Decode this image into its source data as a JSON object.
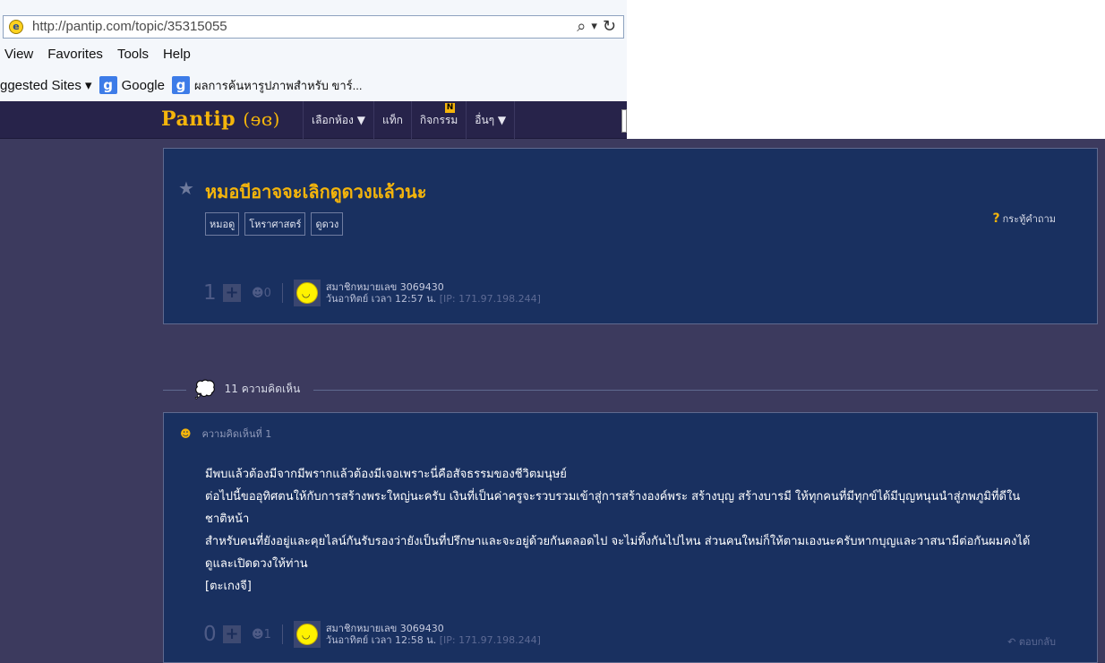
{
  "browser": {
    "url": "http://pantip.com/topic/35315055",
    "menu": [
      "View",
      "Favorites",
      "Tools",
      "Help"
    ],
    "favorites": {
      "suggested": "ggested Sites ▾",
      "google": "Google",
      "other": "ผลการค้นหารูปภาพสำหรับ ขาร์..."
    },
    "icons": {
      "search": "⌕",
      "dropdown": "▾",
      "refresh": "↻"
    }
  },
  "site": {
    "logo": "Pantip",
    "logo_mark": "(ɘɞ)",
    "nav": [
      {
        "label": "เลือกห้อง ▼"
      },
      {
        "label": "แท็ก"
      },
      {
        "label": "กิจกรรม",
        "badge": "N"
      },
      {
        "label": "อื่นๆ ▼"
      }
    ]
  },
  "topic": {
    "title": "หมอบีอาจจะเลิกดูดวงแล้วนะ",
    "tags": [
      "หมอดู",
      "โหราศาสตร์",
      "ดูดวง"
    ],
    "question_link": "กระทู้คำถาม",
    "votes": "1",
    "emotions": "0",
    "author": "สมาชิกหมายเลข 3069430",
    "date": "วันอาทิตย์ เวลา 12:57 น.",
    "ip": "[IP: 171.97.198.244]"
  },
  "comments_count_label": "11 ความคิดเห็น",
  "comment1": {
    "header": "ความคิดเห็นที่ 1",
    "lines": [
      "มีพบแล้วต้องมีจากมีพรากแล้วต้องมีเจอเพราะนี่คือสัจธรรมของชีวิตมนุษย์",
      "ต่อไปนี้ขออุทิศตนให้กับการสร้างพระใหญ่นะครับ เงินที่เป็นค่าครูจะรวบรวมเข้าสู่การสร้างองค์พระ สร้างบุญ สร้างบารมี ให้ทุกคนที่มีทุกข์ได้มีบุญหนุนนำสู่ภพภูมิที่ดีใน",
      "ชาติหน้า",
      "สำหรับคนที่ยังอยู่และคุยไลน์กันรับรองว่ายังเป็นที่ปรึกษาและจะอยู่ด้วยกันตลอดไป จะไม่ทิ้งกันไปไหน ส่วนคนใหม่ก็ให้ตามเองนะครับหากบุญและวาสนามีต่อกันผมคงได้",
      "ดูและเปิดดวงให้ท่าน",
      "[ตะเกงจี]"
    ],
    "votes": "0",
    "emotions": "1",
    "author": "สมาชิกหมายเลข 3069430",
    "date": "วันอาทิตย์ เวลา 12:58 น.",
    "ip": "[IP: 171.97.198.244]",
    "reply": "ตอบกลับ"
  }
}
